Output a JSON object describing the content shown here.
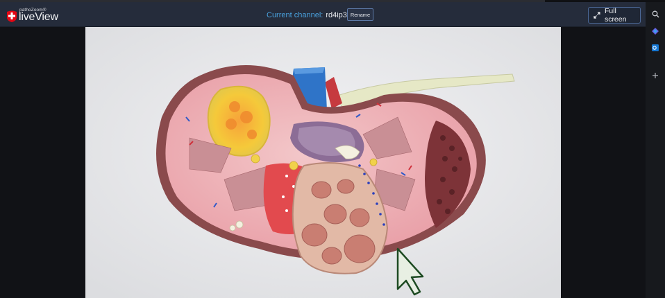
{
  "header": {
    "logo_small": "pathoZoom®",
    "logo_big": "liveView",
    "channel_label": "Current channel:",
    "channel_name": "rd4ip3u",
    "rename_label": "Rename",
    "fullscreen_label": "Full screen"
  },
  "right_rail": {
    "icons": [
      "search-icon",
      "copilot-icon",
      "outlook-icon",
      "add-icon"
    ]
  },
  "colors": {
    "header_bg": "#252c3b",
    "channel_label": "#4aa3e0",
    "logo_red": "#e30613"
  }
}
